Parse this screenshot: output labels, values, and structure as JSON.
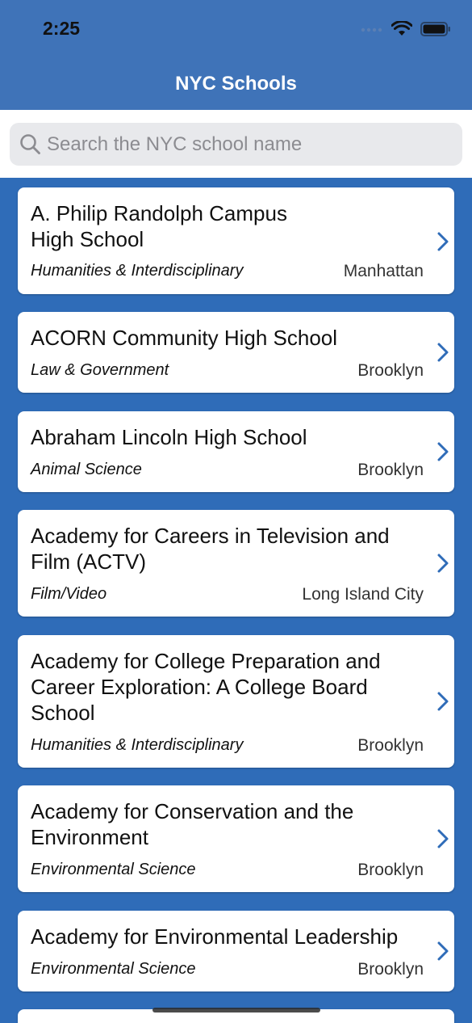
{
  "status_bar": {
    "time": "2:25"
  },
  "nav": {
    "title": "NYC Schools"
  },
  "search": {
    "placeholder": "Search the NYC school name"
  },
  "schools": [
    {
      "name": "A. Philip Randolph Campus High School",
      "name_line1": "A. Philip Randolph Campus",
      "name_line2": "High School",
      "type": "Humanities & Interdisciplinary",
      "borough": "Manhattan"
    },
    {
      "name": "ACORN Community High School",
      "type": "Law & Government",
      "borough": "Brooklyn"
    },
    {
      "name": "Abraham Lincoln High School",
      "type": "Animal Science",
      "borough": "Brooklyn"
    },
    {
      "name": "Academy for Careers in Television and Film (ACTV)",
      "type": "Film/Video",
      "borough": "Long Island City"
    },
    {
      "name": "Academy for College Preparation and Career Exploration: A College Board School",
      "type": "Humanities & Interdisciplinary",
      "borough": "Brooklyn"
    },
    {
      "name": "Academy for Conservation and the Environment",
      "type": "Environmental Science",
      "borough": "Brooklyn"
    },
    {
      "name": "Academy for Environmental Leadership",
      "type": "Environmental Science",
      "borough": "Brooklyn"
    }
  ],
  "colors": {
    "nav_bg": "#3f73b8",
    "list_bg": "#2f6cb8",
    "accent": "#2f6cb8"
  }
}
